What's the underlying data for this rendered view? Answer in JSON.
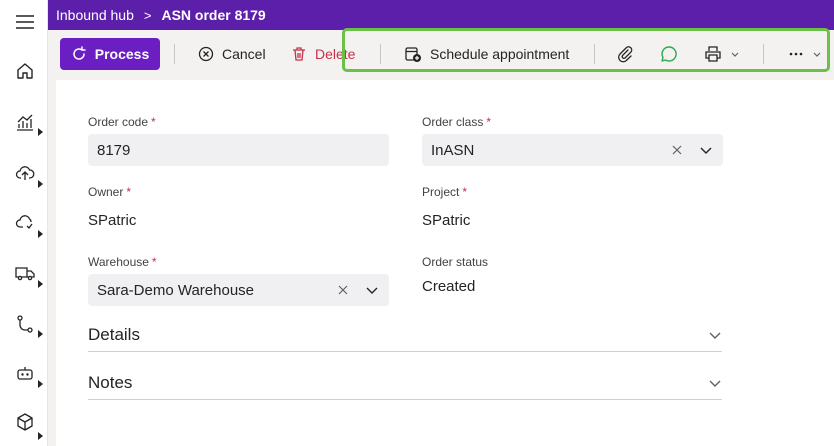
{
  "header": {
    "breadcrumb_parent": "Inbound hub",
    "breadcrumb_separator": ">",
    "breadcrumb_current": "ASN order 8179"
  },
  "toolbar": {
    "process_label": "Process",
    "cancel_label": "Cancel",
    "delete_label": "Delete",
    "schedule_label": "Schedule appointment"
  },
  "form": {
    "order_code": {
      "label": "Order code",
      "value": "8179"
    },
    "order_class": {
      "label": "Order class",
      "value": "InASN"
    },
    "owner": {
      "label": "Owner",
      "value": "SPatric"
    },
    "project": {
      "label": "Project",
      "value": "SPatric"
    },
    "warehouse": {
      "label": "Warehouse",
      "value": "Sara-Demo Warehouse"
    },
    "order_status": {
      "label": "Order status",
      "value": "Created"
    },
    "required_marker": "*"
  },
  "sections": {
    "details": "Details",
    "notes": "Notes"
  },
  "colors": {
    "header": "#5c1fa9",
    "primary": "#6b1ec2",
    "delete": "#c4314b",
    "highlight": "#6cc04a",
    "chat_icon": "#2fa84f"
  }
}
